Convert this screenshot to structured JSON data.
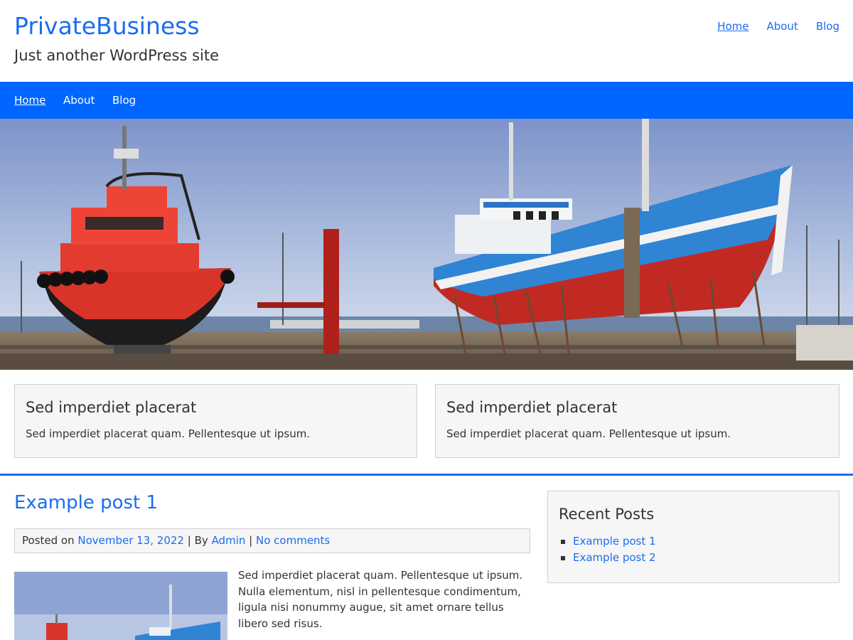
{
  "site": {
    "title": "PrivateBusiness",
    "tagline": "Just another WordPress site"
  },
  "top_nav": [
    {
      "label": "Home",
      "current": true
    },
    {
      "label": "About",
      "current": false
    },
    {
      "label": "Blog",
      "current": false
    }
  ],
  "main_nav": [
    {
      "label": "Home",
      "current": true
    },
    {
      "label": "About",
      "current": false
    },
    {
      "label": "Blog",
      "current": false
    }
  ],
  "hero": {
    "image_subject": "two boats in dry dock at a harbor"
  },
  "features": [
    {
      "title": "Sed imperdiet placerat",
      "text": "Sed imperdiet placerat quam. Pellentesque ut ipsum."
    },
    {
      "title": "Sed imperdiet placerat",
      "text": "Sed imperdiet placerat quam. Pellentesque ut ipsum."
    }
  ],
  "post": {
    "title": "Example post 1",
    "meta_prefix": "Posted on",
    "date": "November 13, 2022",
    "by_label": "By",
    "author": "Admin",
    "comments": "No comments",
    "separator": "|",
    "excerpt": "Sed imperdiet placerat quam. Pellentesque ut ipsum. Nulla elementum, nisl in pellentesque condimentum, ligula nisi nonummy augue, sit amet ornare tellus libero sed risus."
  },
  "sidebar": {
    "recent_posts_title": "Recent Posts",
    "recent_posts": [
      "Example post 1",
      "Example post 2"
    ]
  },
  "colors": {
    "accent": "#0066ff",
    "link": "#1a6cf0",
    "box_bg": "#f6f6f6"
  }
}
